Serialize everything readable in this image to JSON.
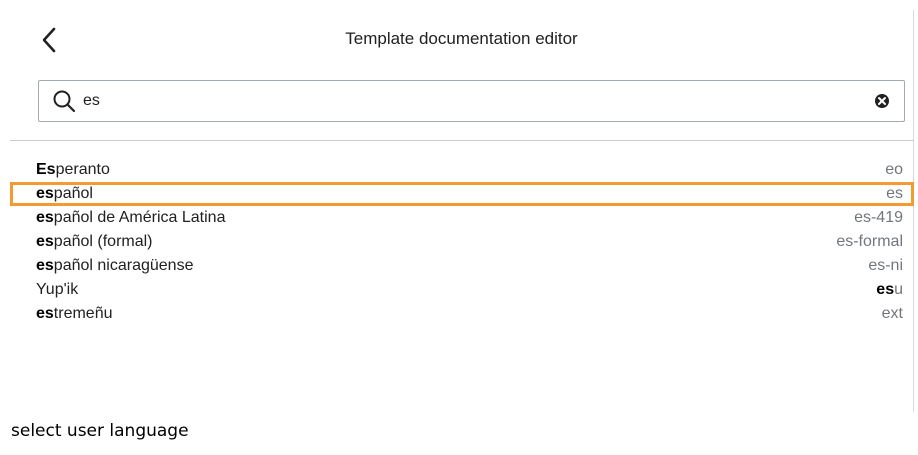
{
  "header": {
    "title": "Template documentation editor",
    "back_icon": "chevron-left-icon"
  },
  "search": {
    "value": "es",
    "placeholder": "",
    "search_icon": "search-icon",
    "clear_icon": "clear-icon"
  },
  "results": [
    {
      "match": "Es",
      "rest": "peranto",
      "code_pre": "eo",
      "code_match": "",
      "code_post": "",
      "highlighted": false
    },
    {
      "match": "es",
      "rest": "pañol",
      "code_pre": "es",
      "code_match": "",
      "code_post": "",
      "highlighted": true
    },
    {
      "match": "es",
      "rest": "pañol de América Latina",
      "code_pre": "es-419",
      "code_match": "",
      "code_post": "",
      "highlighted": false
    },
    {
      "match": "es",
      "rest": "pañol (formal)",
      "code_pre": "es-formal",
      "code_match": "",
      "code_post": "",
      "highlighted": false
    },
    {
      "match": "es",
      "rest": "pañol nicaragüense",
      "code_pre": "es-ni",
      "code_match": "",
      "code_post": "",
      "highlighted": false
    },
    {
      "match": "",
      "rest": "Yup'ik",
      "code_pre": "",
      "code_match": "es",
      "code_post": "u",
      "highlighted": false
    },
    {
      "match": "es",
      "rest": "tremeñu",
      "code_pre": "ext",
      "code_match": "",
      "code_post": "",
      "highlighted": false
    }
  ],
  "caption": "select user language",
  "colors": {
    "highlight_border": "#f59a33",
    "code_text": "#72777d",
    "text": "#202122"
  }
}
